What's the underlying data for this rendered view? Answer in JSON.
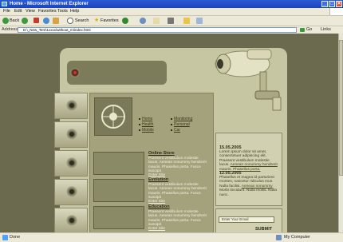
{
  "window": {
    "title": "Home - Microsoft Internet Explorer",
    "buttons": [
      "_",
      "□",
      "✕"
    ]
  },
  "menu": [
    "File",
    "Edit",
    "View",
    "Favorites",
    "Tools",
    "Help"
  ],
  "toolbar": {
    "back_label": "Back",
    "search_label": "Search",
    "favorites_label": "Favorites"
  },
  "address": {
    "label": "Address",
    "value": "D:\\_New_Tem\\1xxxx\\without_m\\index.html",
    "go_label": "Go",
    "links_label": "Links"
  },
  "nav": {
    "col1": [
      "Home",
      "Health",
      "Mobile"
    ],
    "col2": [
      "Monitoring",
      "Personal",
      "Car"
    ]
  },
  "items": [
    {
      "title": "Online Store",
      "desc": "Praesent vestibulum molestie lacus. Aenean nonummy hendrerit mauris. Phasellus porta. Fusce suscipit",
      "more": "Enter Site"
    },
    {
      "title": "Evolution",
      "desc": "Praesent vestibulum molestie lacus. Aenean nonummy hendrerit mauris. Phasellus porta. Fusce suscipit",
      "more": "Enter Site"
    },
    {
      "title": "Education",
      "desc": "Praesent vestibulum molestie lacus. Aenean nonummy hendrerit mauris. Phasellus porta. Fusce suscipit",
      "more": "Enter Site"
    }
  ],
  "news": [
    {
      "date": "15.05.2005",
      "text": "Lorem ipsum dolor sit amet, consectetuer adipiscing elit. Praesent vestibulum molestie lacus.",
      "link1": "Aenean nonummy hendrerit mauris.",
      "link2": "Phasellus porta."
    },
    {
      "date": "12.05.2005",
      "text": "Phasellus et magna id parturient montes, nascetur ridiculus mus. Nulla facilisi.",
      "link1": "Aenean nonummy",
      "text2": "Morbi tincidunt. Nulla mollis. Nulla nunc."
    }
  ],
  "form": {
    "email_placeholder": "Enter Your Email",
    "submit_label": "SUBMIT"
  },
  "status": {
    "text": "Done",
    "zone": "My Computer"
  },
  "colors": {
    "page_bg": "#6b6a4f",
    "frame_bg": "#c7c6a2",
    "panel_bg": "#a4a27c",
    "xp_title": "#2a5bd6"
  },
  "icons": [
    "ie-logo-icon",
    "back-icon",
    "forward-icon",
    "stop-icon",
    "refresh-icon",
    "home-icon",
    "search-icon",
    "favorites-star-icon",
    "media-icon",
    "history-icon",
    "mail-icon",
    "print-icon",
    "go-arrow-icon",
    "computer-icon",
    "security-camera-icon",
    "lens-icon"
  ]
}
